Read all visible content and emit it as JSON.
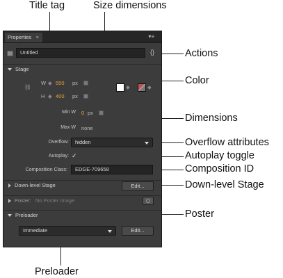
{
  "callouts": {
    "title_tag": "Title tag",
    "size_dimensions": "Size dimensions",
    "actions": "Actions",
    "color": "Color",
    "dimensions": "Dimensions",
    "overflow_attributes": "Overflow attributes",
    "autoplay_toggle": "Autoplay toggle",
    "composition_id": "Composition ID",
    "down_level_stage": "Down-level Stage",
    "poster": "Poster",
    "preloader": "Preloader"
  },
  "panel": {
    "tab_label": "Properties",
    "tab_close": "×",
    "menu_icon": "▾≡",
    "title_value": "Untitled",
    "actions_glyph": "{}",
    "stage_section": "Stage",
    "w_label": "W",
    "w_value": "550",
    "w_unit": "px",
    "h_label": "H",
    "h_value": "400",
    "h_unit": "px",
    "min_w_label": "Min W",
    "min_w_value": "0",
    "min_w_unit": "px",
    "max_w_label": "Max W",
    "max_w_value": "none",
    "overflow_label": "Overflow:",
    "overflow_value": "hidden",
    "autoplay_label": "Autoplay:",
    "autoplay_check": "✓",
    "composition_class_label": "Composition Class:",
    "composition_class_value": "EDGE-709658",
    "down_level_stage_label": "Down-level Stage",
    "down_level_edit": "Edit...",
    "poster_label": "Poster:",
    "poster_value": "No Poster Image",
    "preloader_section": "Preloader",
    "preloader_value": "Immediate",
    "preloader_edit": "Edit..."
  },
  "colors": {
    "panel_bg": "#3c3c3c",
    "value_accent": "#e8a33a"
  }
}
